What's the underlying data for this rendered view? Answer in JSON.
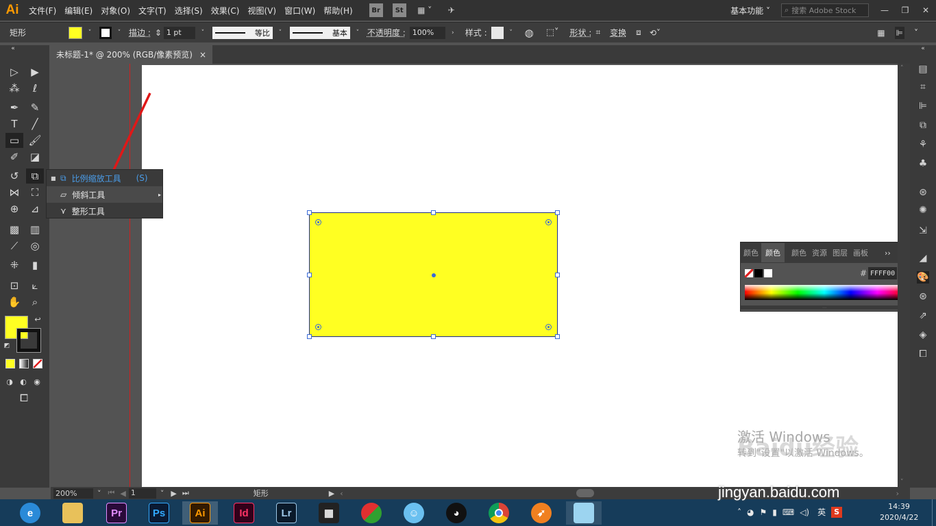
{
  "app": {
    "logo": "Ai"
  },
  "menu": [
    "文件(F)",
    "编辑(E)",
    "对象(O)",
    "文字(T)",
    "选择(S)",
    "效果(C)",
    "视图(V)",
    "窗口(W)",
    "帮助(H)"
  ],
  "menubar_right": {
    "workspace": "基本功能",
    "search_placeholder": "搜索 Adobe Stock",
    "br": "Br",
    "st": "St"
  },
  "control": {
    "object": "矩形",
    "stroke_label": "描边 :",
    "stroke_value": "1 pt",
    "profile1": "等比",
    "profile2": "基本",
    "opacity_label": "不透明度 :",
    "opacity_value": "100%",
    "style_label": "样式 :",
    "shape_label": "形状 :",
    "transform_label": "变换",
    "fill_color": "#ffff22"
  },
  "document": {
    "tab_title": "未标题-1* @ 200% (RGB/像素预览)",
    "close": "×"
  },
  "flyout": {
    "items": [
      {
        "label": "比例缩放工具",
        "shortcut": "(S)",
        "selected": true
      },
      {
        "label": "倾斜工具",
        "shortcut": "",
        "selected": false
      },
      {
        "label": "整形工具",
        "shortcut": "",
        "selected": false
      }
    ]
  },
  "color_panel": {
    "tabs": [
      "颜色",
      "颜色",
      "颜色",
      "资源",
      "图层",
      "画板"
    ],
    "active_tab": "颜色",
    "hex_label": "#",
    "hex_value": "FFFF00"
  },
  "status": {
    "zoom": "200%",
    "artboard": "1",
    "tool": "矩形"
  },
  "taskbar": {
    "apps": [
      "ie",
      "files",
      "Pr",
      "Ps",
      "Ai",
      "Id",
      "Lr",
      "video",
      "media",
      "qq-doll",
      "qq",
      "chrome",
      "sogou",
      "app"
    ],
    "tray": {
      "ime": "英",
      "time": "14:39",
      "date": "2020/4/22"
    }
  },
  "watermark": {
    "line1": "激活 Windows",
    "line2": "转到\"设置\"以激活 Windows。",
    "brand": "Baidu经验",
    "url": "jingyan.baidu.com"
  }
}
